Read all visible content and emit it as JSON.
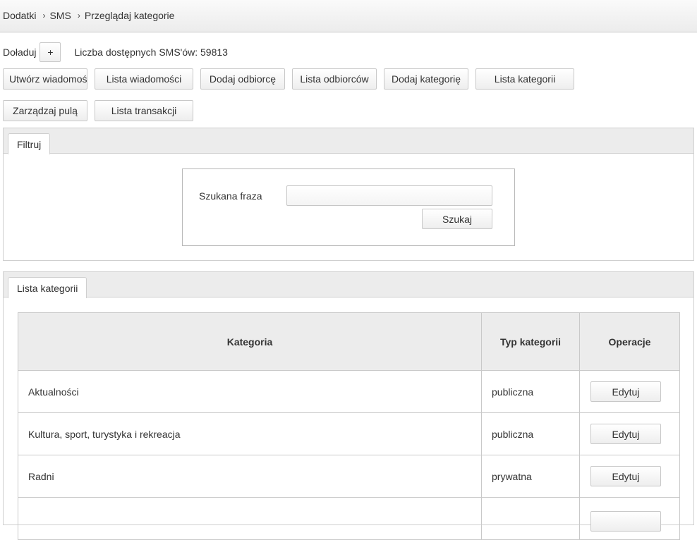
{
  "breadcrumb": {
    "items": [
      "Dodatki",
      "SMS",
      "Przeglądaj kategorie"
    ],
    "separator": "›"
  },
  "recharge": {
    "label": "Doładuj",
    "plus_label": "+",
    "sms_count_text": "Liczba dostępnych SMS'ów: 59813"
  },
  "actions": [
    "Utwórz wiadomość",
    "Lista wiadomości",
    "Dodaj odbiorcę",
    "Lista odbiorców",
    "Dodaj kategorię",
    "Lista kategorii",
    "Zarządzaj pulą",
    "Lista transakcji"
  ],
  "filter": {
    "tab_label": "Filtruj",
    "search_label": "Szukana fraza",
    "search_value": "",
    "search_button": "Szukaj"
  },
  "list": {
    "tab_label": "Lista kategorii",
    "columns": [
      "Kategoria",
      "Typ kategorii",
      "Operacje"
    ],
    "rows": [
      {
        "category": "Aktualności",
        "type": "publiczna",
        "action": "Edytuj"
      },
      {
        "category": "Kultura, sport, turystyka i rekreacja",
        "type": "publiczna",
        "action": "Edytuj"
      },
      {
        "category": "Radni",
        "type": "prywatna",
        "action": "Edytuj"
      }
    ]
  }
}
